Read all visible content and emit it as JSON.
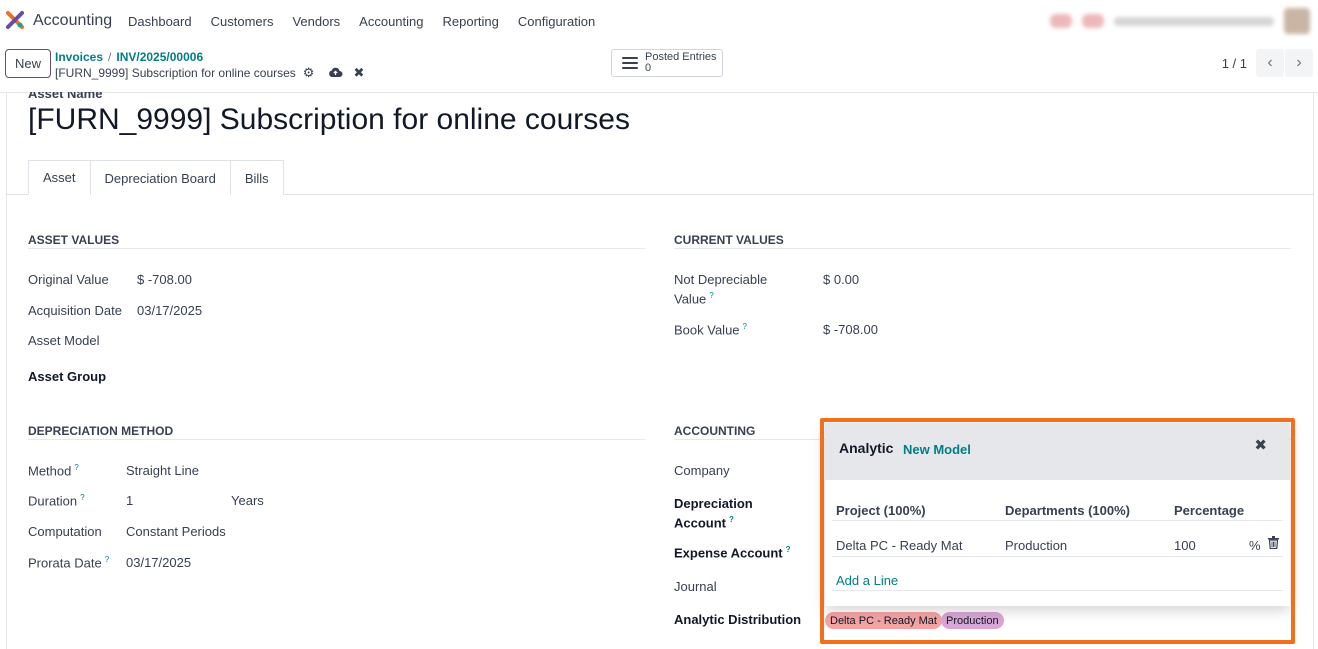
{
  "navbar": {
    "app_name": "Accounting",
    "menu": [
      "Dashboard",
      "Customers",
      "Vendors",
      "Accounting",
      "Reporting",
      "Configuration"
    ]
  },
  "control": {
    "new_label": "New",
    "breadcrumb_parent": "Invoices",
    "breadcrumb_sep": "/",
    "breadcrumb_current": "INV/2025/00006",
    "record_name": "[FURN_9999] Subscription for online courses",
    "smart_button": {
      "label": "Posted Entries",
      "count": "0"
    },
    "pager": "1 / 1"
  },
  "form": {
    "name_caption": "Asset Name",
    "title": "[FURN_9999] Subscription for online courses",
    "tabs": [
      "Asset",
      "Depreciation Board",
      "Bills"
    ],
    "asset_values": {
      "heading": "ASSET VALUES",
      "original_value_label": "Original Value",
      "original_value": "$ -708.00",
      "acquisition_date_label": "Acquisition Date",
      "acquisition_date": "03/17/2025",
      "asset_model_label": "Asset Model",
      "asset_group_label": "Asset Group"
    },
    "current_values": {
      "heading": "CURRENT VALUES",
      "not_depreciable_label_1": "Not Depreciable",
      "not_depreciable_label_2": "Value",
      "not_depreciable_value": "$ 0.00",
      "book_value_label": "Book Value",
      "book_value": "$ -708.00"
    },
    "depreciation_method": {
      "heading": "DEPRECIATION METHOD",
      "method_label": "Method",
      "method": "Straight Line",
      "duration_label": "Duration",
      "duration": "1",
      "duration_unit": "Years",
      "computation_label": "Computation",
      "computation": "Constant Periods",
      "prorata_label": "Prorata Date",
      "prorata": "03/17/2025"
    },
    "accounting": {
      "heading": "ACCOUNTING",
      "company_label": "Company",
      "dep_account_label_1": "Depreciation",
      "dep_account_label_2": "Account",
      "expense_account_label": "Expense Account",
      "journal_label": "Journal",
      "analytic_label": "Analytic Distribution",
      "tags": [
        "Delta PC - Ready Mat",
        "Production"
      ]
    },
    "help_mark": "?"
  },
  "analytic_popover": {
    "title": "Analytic",
    "new_model": "New Model",
    "columns": [
      "Project (100%)",
      "Departments (100%)",
      "Percentage"
    ],
    "row": {
      "project": "Delta PC - Ready Mat",
      "department": "Production",
      "percentage": "100",
      "unit": "%"
    },
    "add_line": "Add a Line"
  },
  "colors": {
    "accent": "#017e84",
    "highlight_outline": "#f36f1c",
    "tag_project": "#f4a3a3",
    "tag_department": "#d9a6d6"
  }
}
